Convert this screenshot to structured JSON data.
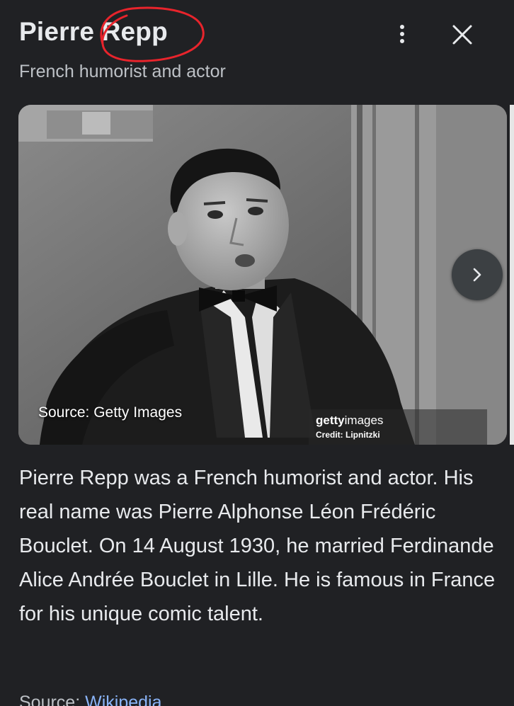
{
  "header": {
    "title": "Pierre Repp",
    "subtitle": "French humorist and actor",
    "annotation_color": "#e8242c"
  },
  "toolbar": {
    "more_icon": "more-vert-icon",
    "close_icon": "close-icon"
  },
  "image": {
    "source_label": "Source: Getty Images",
    "watermark_brand": "getty",
    "watermark_brand_suffix": "images",
    "watermark_credit": "Credit: Lipnitzki",
    "next_icon": "chevron-right-icon"
  },
  "description": {
    "text": "Pierre Repp was a French humorist and actor. His real name was Pierre Alphonse Léon Frédéric Bouclet. On 14 August 1930, he married Ferdinande Alice Andrée Bouclet in Lille. He is famous in France for his unique comic talent."
  },
  "source": {
    "prefix": "Source:",
    "link": "Wikipedia"
  },
  "colors": {
    "background": "#202124",
    "text": "#e8eaed",
    "muted": "#bdc1c6",
    "link": "#8ab4f8"
  }
}
